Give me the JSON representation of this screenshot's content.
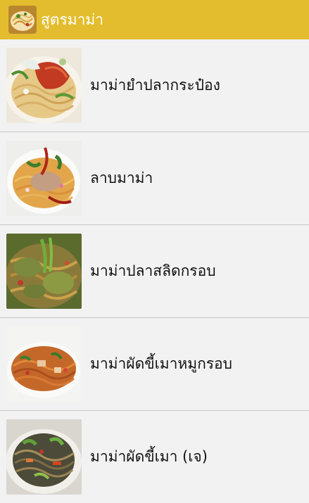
{
  "app": {
    "title": "สูตรมาม่า",
    "icon": "noodle-dish-icon",
    "colors": {
      "action_bar": "#e4bd2e",
      "background": "#f2f2f2",
      "divider": "#c6c6c6",
      "title_text": "#ffffff",
      "item_text": "#111111"
    }
  },
  "recipes": [
    {
      "label": "มาม่ายำปลากระป๋อง",
      "image": "spicy-canned-fish-noodle-salad-photo"
    },
    {
      "label": "ลาบมาม่า",
      "image": "larb-noodle-photo"
    },
    {
      "label": "มาม่าปลาสลิดกรอบ",
      "image": "crispy-fish-noodle-photo"
    },
    {
      "label": "มาม่าผัดขี้เมาหมูกรอบ",
      "image": "drunken-noodle-crispy-pork-photo"
    },
    {
      "label": "มาม่าผัดขี้เมา (เจ)",
      "image": "vegetarian-drunken-noodle-photo"
    }
  ]
}
